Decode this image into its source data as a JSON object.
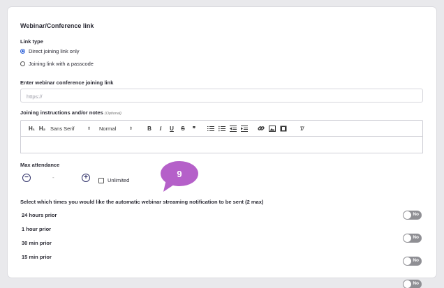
{
  "section": {
    "title": "Webinar/Conference link"
  },
  "link_type": {
    "label": "Link type",
    "options": [
      {
        "label": "Direct joining link only",
        "selected": true
      },
      {
        "label": "Joining link with a passcode",
        "selected": false
      }
    ]
  },
  "join_link": {
    "label": "Enter webinar conference joining link",
    "placeholder": "https://"
  },
  "instructions": {
    "label": "Joining instructions and/or notes",
    "optional": "(Optional)"
  },
  "toolbar": {
    "h1": "H₁",
    "h2": "H₂",
    "font": "Sans Serif",
    "size": "Normal",
    "bold": "B",
    "italic": "I",
    "underline": "U",
    "strike": "S",
    "quote": "❞",
    "clear": "T̸",
    "icons": [
      "ordered-list-icon",
      "bullet-list-icon",
      "outdent-icon",
      "indent-icon",
      "link-icon",
      "image-icon",
      "video-icon",
      "clear-format-icon"
    ]
  },
  "attendance": {
    "label": "Max attendance",
    "value": "-",
    "minus": "−",
    "plus": "+",
    "unlimited_label": "Unlimited",
    "unlimited_checked": false
  },
  "callout": {
    "number": "9",
    "color": "#b560c9"
  },
  "notifications": {
    "heading": "Select which times you would like the automatic webinar streaming notification to be sent (2 max)",
    "rows": [
      {
        "label": "24 hours prior",
        "state": "No"
      },
      {
        "label": "1 hour prior",
        "state": "No"
      },
      {
        "label": "30 min prior",
        "state": "No"
      },
      {
        "label": "15 min prior",
        "state": "No"
      }
    ]
  },
  "colors": {
    "accent": "#2b5fd9",
    "toggle_off": "#8f8f94",
    "stepper": "#33346b"
  }
}
